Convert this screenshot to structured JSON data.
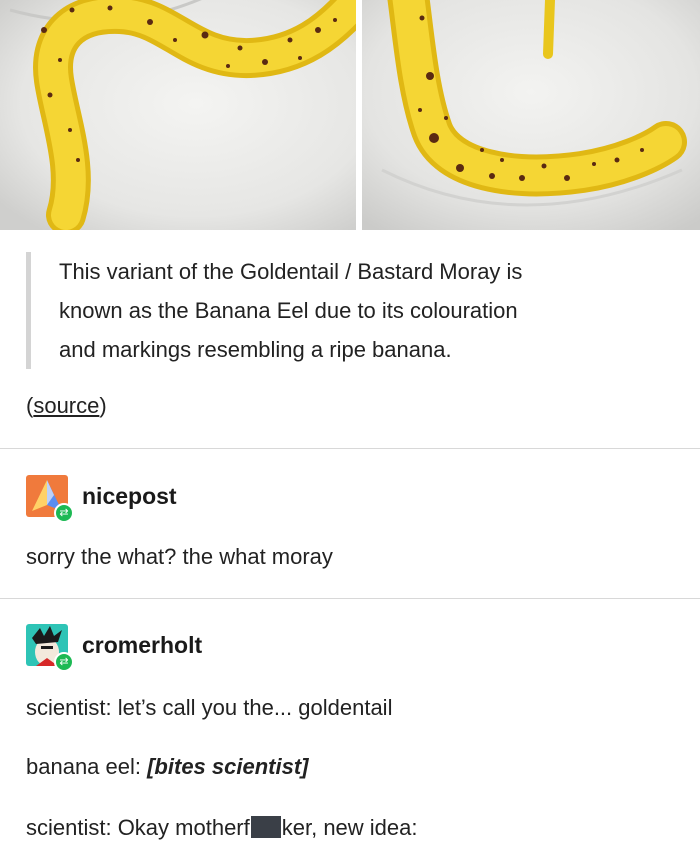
{
  "quote": {
    "lines": [
      "This variant of the Goldentail / Bastard Moray is",
      "known as the Banana Eel due to its colouration",
      "and markings resembling a ripe banana."
    ]
  },
  "source": {
    "open": "(",
    "label": "source",
    "close": ")"
  },
  "posts": [
    {
      "username": "nicepost",
      "lines": [
        {
          "text": "sorry the what? the what moray"
        }
      ]
    },
    {
      "username": "cromerholt",
      "lines": [
        {
          "text": "scientist: let’s call you the... goldentail"
        },
        {
          "prefix": "banana eel: ",
          "action": "[bites scientist]"
        },
        {
          "before": "scientist: Okay motherf",
          "after": "ker, new idea:"
        }
      ]
    }
  ],
  "colors": {
    "eel": "#f2cf2a",
    "reblog_badge": "#1db954",
    "quote_bar": "#d4d4d4",
    "divider": "#d8d8d8"
  }
}
